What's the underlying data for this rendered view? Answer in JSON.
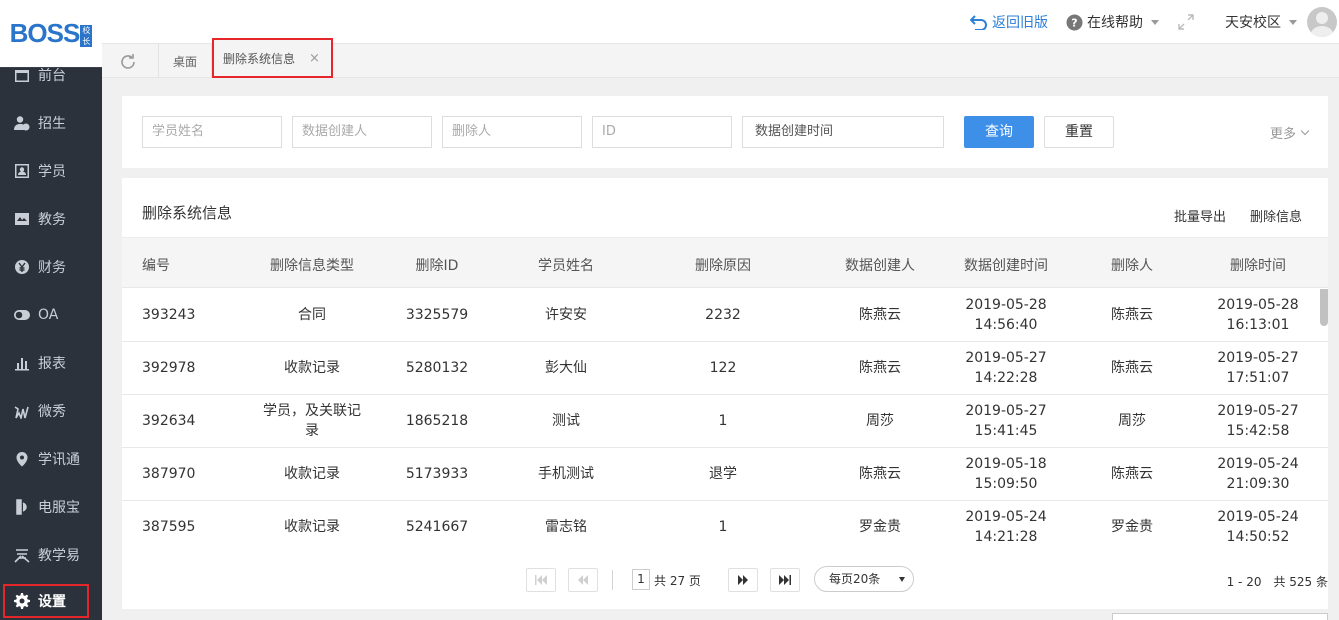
{
  "logo": {
    "text": "BOSS",
    "badge": "校长"
  },
  "sidebar": {
    "items": [
      {
        "label": "前台",
        "icon": "calendar-icon"
      },
      {
        "label": "招生",
        "icon": "user-add-icon"
      },
      {
        "label": "学员",
        "icon": "id-card-icon"
      },
      {
        "label": "教务",
        "icon": "book-icon"
      },
      {
        "label": "财务",
        "icon": "yen-icon"
      },
      {
        "label": "OA",
        "icon": "toggle-icon"
      },
      {
        "label": "报表",
        "icon": "bar-chart-icon"
      },
      {
        "label": "微秀",
        "icon": "wei-icon"
      },
      {
        "label": "学讯通",
        "icon": "location-icon"
      },
      {
        "label": "电服宝",
        "icon": "phone-icon"
      },
      {
        "label": "教学易",
        "icon": "jiao-icon"
      },
      {
        "label": "设置",
        "icon": "gear-icon"
      }
    ]
  },
  "header": {
    "back_old": "返回旧版",
    "help": "在线帮助",
    "campus": "天安校区"
  },
  "tabs": {
    "desk": "桌面",
    "active": "删除系统信息",
    "close": "×"
  },
  "filter": {
    "student_name": "学员姓名",
    "data_creator": "数据创建人",
    "deleter": "删除人",
    "id": "ID",
    "create_time": "数据创建时间",
    "query": "查询",
    "reset": "重置",
    "more": "更多"
  },
  "table": {
    "title": "删除系统信息",
    "export": "批量导出",
    "delete_info": "删除信息",
    "columns": [
      "编号",
      "删除信息类型",
      "删除ID",
      "学员姓名",
      "删除原因",
      "数据创建人",
      "数据创建时间",
      "删除人",
      "删除时间"
    ],
    "rows": [
      [
        "393243",
        "合同",
        "3325579",
        "许安安",
        "2232",
        "陈燕云",
        "2019-05-28",
        "14:56:40",
        "陈燕云",
        "2019-05-28",
        "16:13:01"
      ],
      [
        "392978",
        "收款记录",
        "5280132",
        "彭大仙",
        "122",
        "陈燕云",
        "2019-05-27",
        "14:22:28",
        "陈燕云",
        "2019-05-27",
        "17:51:07"
      ],
      [
        "392634",
        "学员，及关联记",
        "录",
        "1865218",
        "测试",
        "1",
        "周莎",
        "2019-05-27",
        "15:41:45",
        "周莎",
        "2019-05-27",
        "15:42:58"
      ],
      [
        "387970",
        "收款记录",
        "5173933",
        "手机测试",
        "退学",
        "陈燕云",
        "2019-05-18",
        "15:09:50",
        "陈燕云",
        "2019-05-24",
        "21:09:30"
      ],
      [
        "387595",
        "收款记录",
        "5241667",
        "雷志铭",
        "1",
        "罗金贵",
        "2019-05-24",
        "14:21:28",
        "罗金贵",
        "2019-05-24",
        "14:50:52"
      ]
    ]
  },
  "pager": {
    "page": "1",
    "total_pages": "共 27 页",
    "per_page": "每页20条",
    "range": "1 - 20　共 525 条"
  }
}
